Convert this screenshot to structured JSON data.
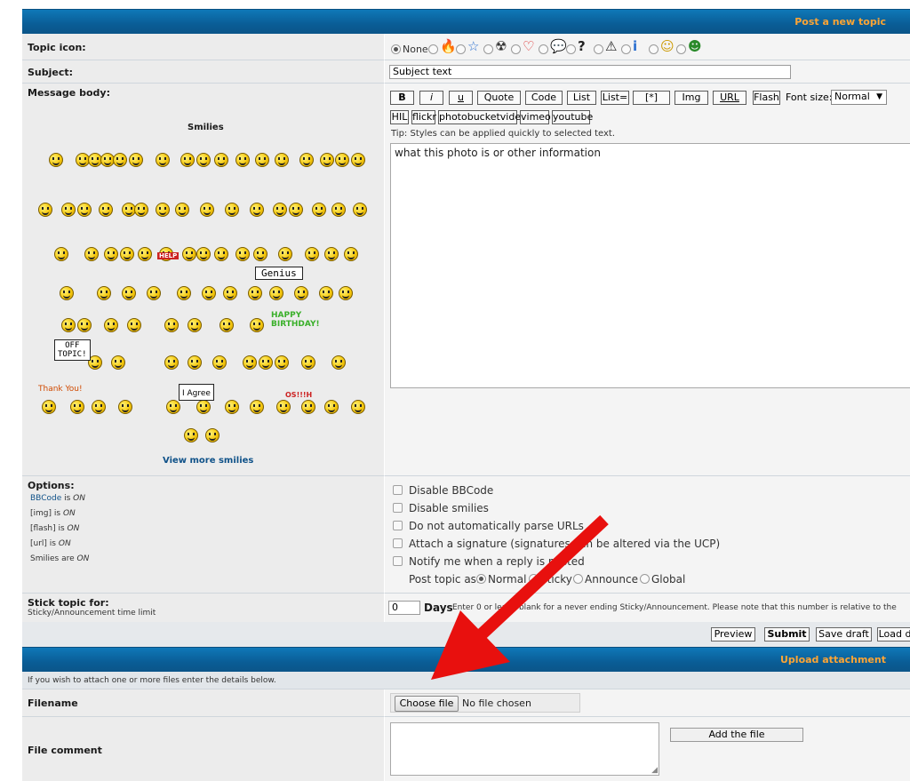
{
  "header": {
    "title": "Post a new topic"
  },
  "topic_icon": {
    "label": "Topic icon:",
    "none_label": "None",
    "icons": [
      "fire-icon",
      "star-icon",
      "radioactive-icon",
      "heart-icon",
      "speech-icon",
      "question-icon",
      "warning-icon",
      "info-icon",
      "lightbulb-icon",
      "grin-icon"
    ]
  },
  "subject": {
    "label": "Subject:",
    "value": "Subject text"
  },
  "message": {
    "label": "Message body:",
    "smilies_title": "Smilies",
    "view_more": "View more smilies",
    "toolbar": [
      "B",
      "i",
      "u",
      "Quote",
      "Code",
      "List",
      "List=",
      "[*]",
      "Img",
      "URL",
      "Flash"
    ],
    "font_size_label": "Font size:",
    "font_size_value": "Normal",
    "toolbar2": [
      "HIL",
      "flickr",
      "photobucketvideo",
      "vimeo",
      "youtube"
    ],
    "tip": "Tip: Styles can be applied quickly to selected text.",
    "body_text": "what this photo is or other information",
    "smiley_captions": {
      "genius": "Genius",
      "offtopic": "OFF\nTOPIC!",
      "thankyou": "Thank You!",
      "agree": "I Agree",
      "birthday": "HAPPY\nBIRTHDAY!",
      "help": "HELP",
      "oops": "OS!!!H"
    }
  },
  "options": {
    "label": "Options:",
    "status": [
      {
        "name": "BBCode",
        "suffix": " is ",
        "state": "ON"
      },
      {
        "name": "[img]",
        "suffix": " is ",
        "state": "ON"
      },
      {
        "name": "[flash]",
        "suffix": " is ",
        "state": "ON"
      },
      {
        "name": "[url]",
        "suffix": " is ",
        "state": "ON"
      },
      {
        "name": "Smilies",
        "suffix": " are ",
        "state": "ON"
      }
    ],
    "checkboxes": [
      "Disable BBCode",
      "Disable smilies",
      "Do not automatically parse URLs",
      "Attach a signature (signatures can be altered via the UCP)",
      "Notify me when a reply is posted"
    ],
    "post_as_label": "Post topic as:",
    "post_as": [
      "Normal",
      "Sticky",
      "Announce",
      "Global"
    ],
    "post_as_selected": "Normal"
  },
  "stick": {
    "label": "Stick topic for:",
    "sublabel": "Sticky/Announcement time limit",
    "value": "0",
    "days_label": "Days",
    "note": "Enter 0 or leave blank for a never ending Sticky/Announcement. Please note that this number is relative to the"
  },
  "actions": [
    "Preview",
    "Submit",
    "Save draft",
    "Load d"
  ],
  "attachment": {
    "title": "Upload attachment",
    "hint": "If you wish to attach one or more files enter the details below.",
    "filename_label": "Filename",
    "choose_label": "Choose file",
    "no_file": "No file chosen",
    "comment_label": "File comment",
    "add_label": "Add the file"
  },
  "colors": {
    "header_bg": "#0b6aa8",
    "header_text": "#ffa534",
    "link": "#105289",
    "arrow": "#e8100e"
  }
}
